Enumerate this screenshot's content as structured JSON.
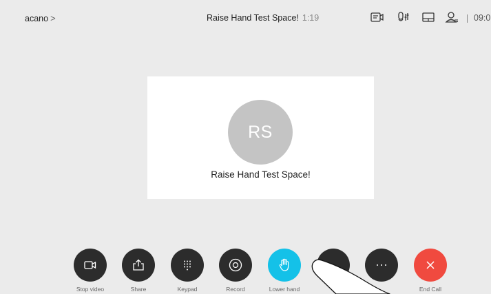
{
  "header": {
    "device_name": "acano",
    "device_chevron": ">",
    "call_title": "Raise Hand Test Space!",
    "call_timer": "1:19",
    "clock": "09:0",
    "separator": "|",
    "icons": [
      "self-view-icon",
      "audio-settings-icon",
      "layout-icon",
      "participants-icon"
    ]
  },
  "participant": {
    "initials": "RS",
    "name": "Raise Hand Test Space!",
    "avatar_color": "#c4c4c4"
  },
  "toolbar": {
    "buttons": [
      {
        "label": "Stop video",
        "icon": "video-camera-icon"
      },
      {
        "label": "Share",
        "icon": "share-icon"
      },
      {
        "label": "Keypad",
        "icon": "keypad-icon"
      },
      {
        "label": "Record",
        "icon": "record-icon"
      },
      {
        "label": "Lower hand",
        "icon": "hand-icon",
        "state": "active"
      },
      {
        "label": "",
        "icon": "more-dot-icon"
      },
      {
        "label": "",
        "icon": "more-icon"
      },
      {
        "label": "End Call",
        "icon": "close-icon",
        "state": "danger"
      }
    ],
    "active_color": "#14c1e8",
    "end_call_color": "#f04a3f",
    "button_color": "#2c2c2c"
  }
}
